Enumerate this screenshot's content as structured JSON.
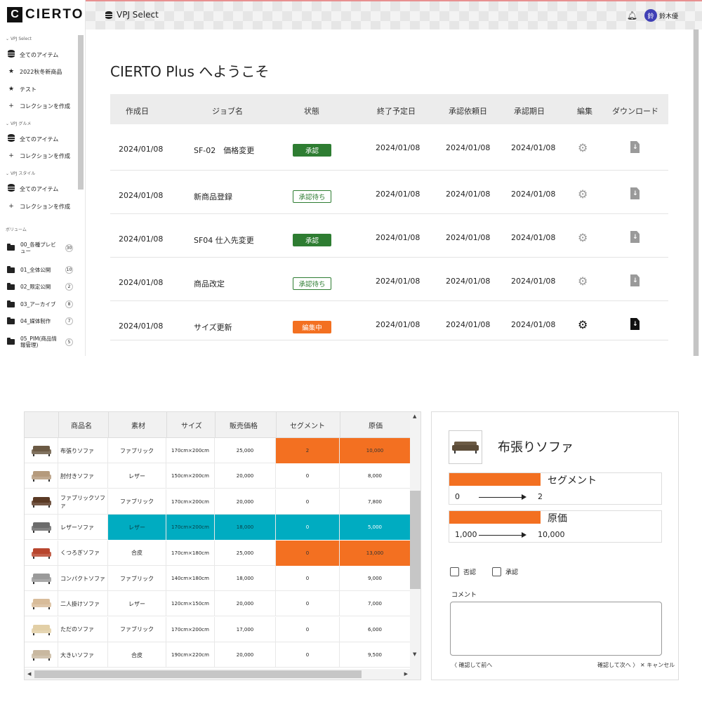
{
  "app": {
    "logo_mark": "C",
    "logo_text": "CIERTO",
    "topbar_title": "VPJ Select",
    "avatar_char": "鈴",
    "username": "鈴木優",
    "bell_icon": "bell-icon"
  },
  "sidebar": {
    "sections": [
      {
        "label": "VPJ Select",
        "items": [
          "全てのアイテム",
          "2022秋冬新商品",
          "テスト",
          "コレクションを作成"
        ]
      },
      {
        "label": "VPJ グルメ",
        "items": [
          "全てのアイテム",
          "コレクションを作成"
        ]
      },
      {
        "label": "VPJ スタイル",
        "items": [
          "全てのアイテム",
          "コレクションを作成"
        ]
      }
    ],
    "volume_label": "ボリューム",
    "volumes": [
      {
        "name": "00_各種プレビュー",
        "count": "30"
      },
      {
        "name": "01_全体公開",
        "count": "10"
      },
      {
        "name": "02_限定公開",
        "count": "2"
      },
      {
        "name": "03_アーカイブ",
        "count": "8"
      },
      {
        "name": "04_媒体制作",
        "count": "7"
      },
      {
        "name": "05_PIM(商品情報管理)",
        "count": "5"
      }
    ]
  },
  "main": {
    "welcome": "CIERTO Plus へようこそ",
    "columns": [
      "作成日",
      "ジョブ名",
      "状態",
      "終了予定日",
      "承認依頼日",
      "承認期日",
      "編集",
      "ダウンロード"
    ],
    "jobs": [
      {
        "created": "2024/01/08",
        "name": "SF-02　価格変更",
        "status": "承認",
        "status_type": "approved",
        "end": "2024/01/08",
        "requested": "2024/01/08",
        "due": "2024/01/08",
        "active": false
      },
      {
        "created": "2024/01/08",
        "name": "新商品登録",
        "status": "承認待ち",
        "status_type": "pending",
        "end": "2024/01/08",
        "requested": "2024/01/08",
        "due": "2024/01/08",
        "active": false
      },
      {
        "created": "2024/01/08",
        "name": "SF04 仕入先変更",
        "status": "承認",
        "status_type": "approved",
        "end": "2024/01/08",
        "requested": "2024/01/08",
        "due": "2024/01/08",
        "active": false
      },
      {
        "created": "2024/01/08",
        "name": "商品改定",
        "status": "承認待ち",
        "status_type": "pending",
        "end": "2024/01/08",
        "requested": "2024/01/08",
        "due": "2024/01/08",
        "active": false
      },
      {
        "created": "2024/01/08",
        "name": "サイズ更新",
        "status": "編集中",
        "status_type": "editing",
        "end": "2024/01/08",
        "requested": "2024/01/08",
        "due": "2024/01/08",
        "active": true
      }
    ]
  },
  "products": {
    "columns": [
      "商品名",
      "素材",
      "サイズ",
      "販売価格",
      "セグメント",
      "原価"
    ],
    "rows": [
      {
        "name": "布張りソファ",
        "material": "ファブリック",
        "size": "170cm×200cm",
        "price": "25,000",
        "segment": "2",
        "cost": "10,000",
        "hl": "orange-right",
        "thumb_color": "#6b5a44"
      },
      {
        "name": "肘付きソファ",
        "material": "レザー",
        "size": "150cm×200cm",
        "price": "20,000",
        "segment": "0",
        "cost": "8,000",
        "hl": "",
        "thumb_color": "#b59a7c"
      },
      {
        "name": "ファブリックソファ",
        "material": "ファブリック",
        "size": "170cm×200cm",
        "price": "20,000",
        "segment": "0",
        "cost": "7,800",
        "hl": "",
        "thumb_color": "#5a3a25"
      },
      {
        "name": "レザーソファ",
        "material": "レザー",
        "size": "170cm×200cm",
        "price": "18,000",
        "segment": "0",
        "cost": "5,000",
        "hl": "teal",
        "thumb_color": "#6c6c6c"
      },
      {
        "name": "くつろぎソファ",
        "material": "合皮",
        "size": "170cm×180cm",
        "price": "25,000",
        "segment": "0",
        "cost": "13,000",
        "hl": "orange-right",
        "thumb_color": "#b8462e"
      },
      {
        "name": "コンパクトソファ",
        "material": "ファブリック",
        "size": "140cm×180cm",
        "price": "18,000",
        "segment": "0",
        "cost": "9,000",
        "hl": "",
        "thumb_color": "#9a9a9a"
      },
      {
        "name": "二人掛けソファ",
        "material": "レザー",
        "size": "120cm×150cm",
        "price": "20,000",
        "segment": "0",
        "cost": "7,000",
        "hl": "",
        "thumb_color": "#d8bc9a"
      },
      {
        "name": "ただのソファ",
        "material": "ファブリック",
        "size": "170cm×200cm",
        "price": "17,000",
        "segment": "0",
        "cost": "6,000",
        "hl": "",
        "thumb_color": "#e2cfa6"
      },
      {
        "name": "大きいソファ",
        "material": "合皮",
        "size": "190cm×220cm",
        "price": "20,000",
        "segment": "0",
        "cost": "9,500",
        "hl": "",
        "thumb_color": "#c9b8a0"
      }
    ]
  },
  "detail": {
    "title": "布張りソファ",
    "rules": [
      {
        "label": "セグメント",
        "from": "0",
        "to": "2"
      },
      {
        "label": "原価",
        "from": "1,000",
        "to": "10,000"
      }
    ],
    "reject_label": "否認",
    "approve_label": "承認",
    "comment_label": "コメント",
    "prev_link": "〈 確認して前へ",
    "next_link": "確認して次へ 〉",
    "cancel_link": "✕ キャンセル"
  },
  "colors": {
    "approved": "#2e7d32",
    "editing": "#f37021",
    "highlight_orange": "#f37021",
    "highlight_teal": "#00acc1"
  }
}
